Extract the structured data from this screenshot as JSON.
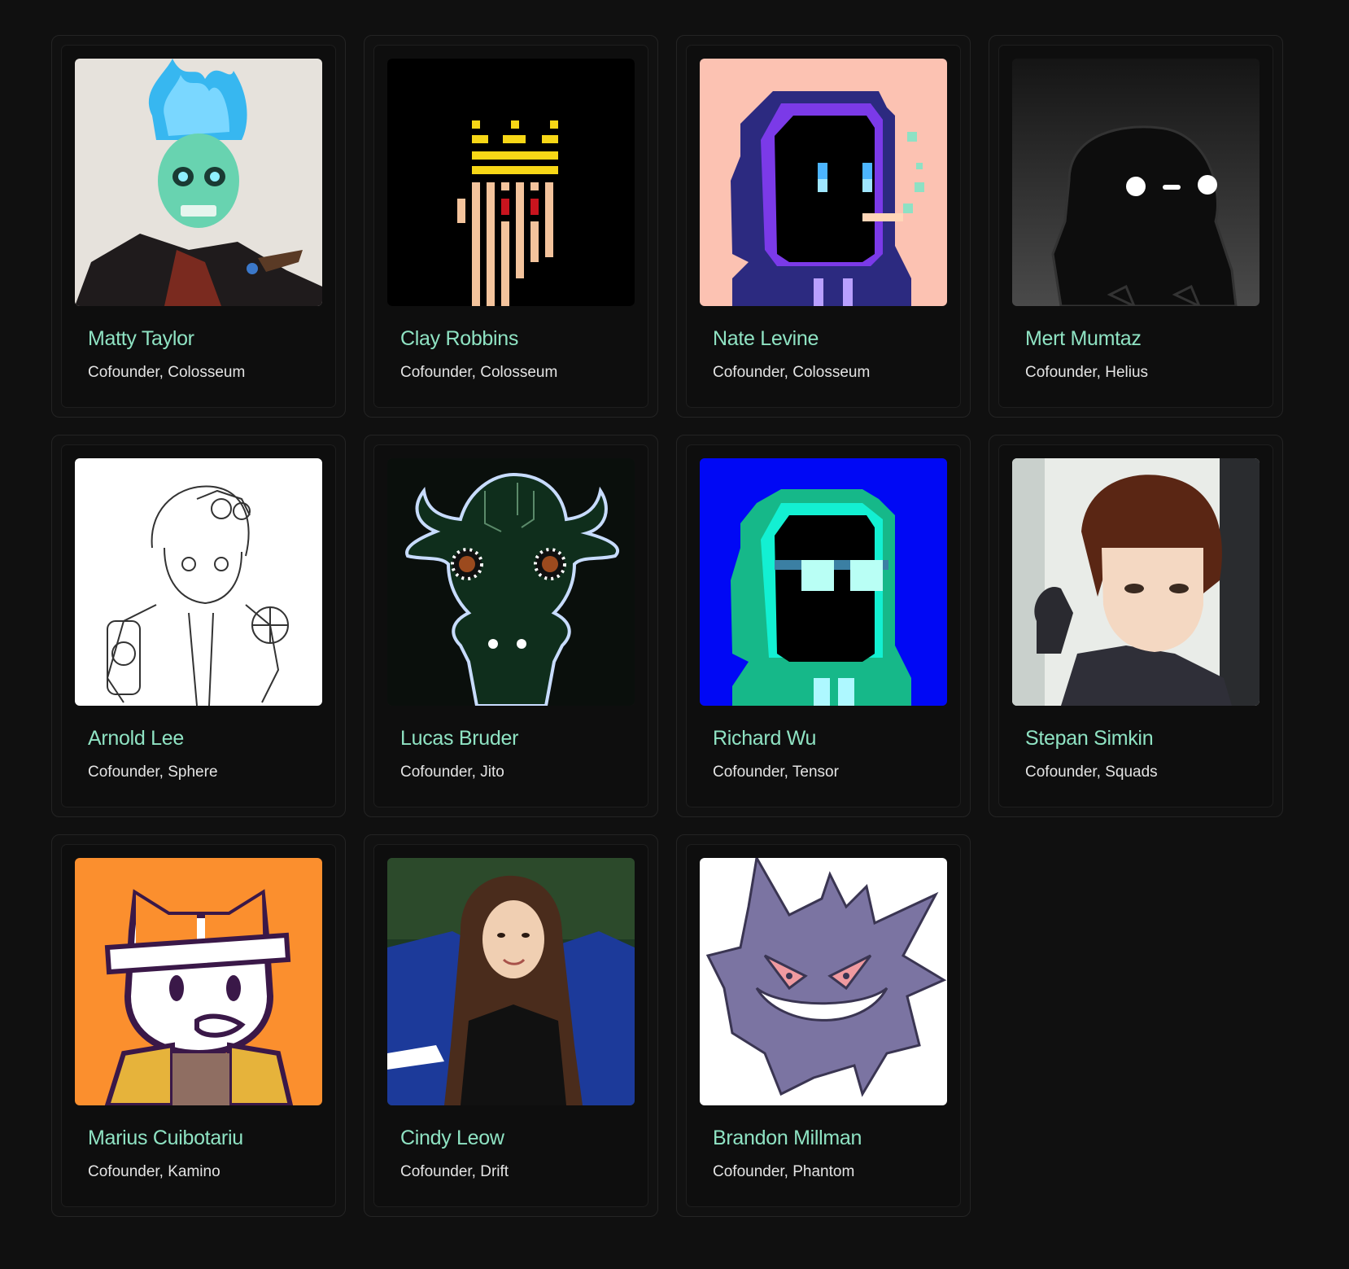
{
  "people": [
    {
      "name": "Matty Taylor",
      "role": "Cofounder, Colosseum",
      "avatar": "skull-flame-avatar"
    },
    {
      "name": "Clay Robbins",
      "role": "Cofounder, Colosseum",
      "avatar": "pixel-crown-avatar"
    },
    {
      "name": "Nate Levine",
      "role": "Cofounder, Colosseum",
      "avatar": "pixel-hoodie-purple-avatar"
    },
    {
      "name": "Mert Mumtaz",
      "role": "Cofounder, Helius",
      "avatar": "dark-glowing-eyes-avatar"
    },
    {
      "name": "Arnold Lee",
      "role": "Cofounder, Sphere",
      "avatar": "sketch-character-avatar"
    },
    {
      "name": "Lucas Bruder",
      "role": "Cofounder, Jito",
      "avatar": "circuit-bull-avatar"
    },
    {
      "name": "Richard Wu",
      "role": "Cofounder, Tensor",
      "avatar": "pixel-hoodie-green-avatar"
    },
    {
      "name": "Stepan Simkin",
      "role": "Cofounder, Squads",
      "avatar": "anime-portrait-avatar"
    },
    {
      "name": "Marius Cuibotariu",
      "role": "Cofounder, Kamino",
      "avatar": "fox-headband-avatar"
    },
    {
      "name": "Cindy Leow",
      "role": "Cofounder, Drift",
      "avatar": "photo-portrait-avatar"
    },
    {
      "name": "Brandon Millman",
      "role": "Cofounder, Phantom",
      "avatar": "ghost-monster-avatar"
    }
  ],
  "colors": {
    "background": "#101010",
    "name": "#8fe3c3",
    "role": "#e4e4e4"
  }
}
